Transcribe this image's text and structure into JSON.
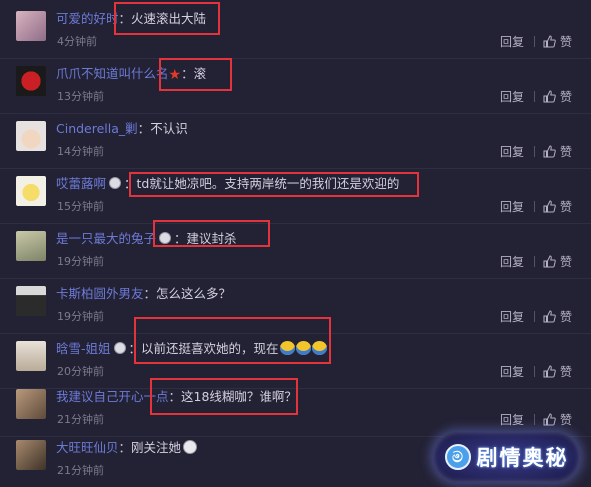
{
  "actions": {
    "reply": "回复",
    "like": "赞"
  },
  "comments": [
    {
      "user": "可爱的好时",
      "text": "火速滚出大陆",
      "time": "4分钟前"
    },
    {
      "user": "爪爪不知道叫什么名",
      "text": "滚",
      "time": "13分钟前"
    },
    {
      "user": "Cinderella_剿",
      "text": "不认识",
      "time": "14分钟前"
    },
    {
      "user": "哎蕾蕗啊",
      "text": "td就让她凉吧。支持两岸统一的我们还是欢迎的",
      "time": "15分钟前"
    },
    {
      "user": "是一只最大的兔子",
      "text": "建议封杀",
      "time": "19分钟前"
    },
    {
      "user": "卡斯柏圆外男友",
      "text": "怎么这么多？",
      "time": "19分钟前"
    },
    {
      "user": "晗雪-姐姐",
      "text": "以前还挺喜欢她的，现在",
      "time": "20分钟前"
    },
    {
      "user": "我建议自己开心一点",
      "text": "这18线糊咖？谁啊？",
      "time": "21分钟前"
    },
    {
      "user": "大旺旺仙贝",
      "text": "刚关注她",
      "time": "21分钟前"
    }
  ],
  "colon": "：",
  "watermark": {
    "icon": "ring-logo-icon",
    "text": "剧情奥秘"
  },
  "colors": {
    "background": "#232134",
    "username": "#6c7bd6",
    "highlight": "#e5333b"
  }
}
